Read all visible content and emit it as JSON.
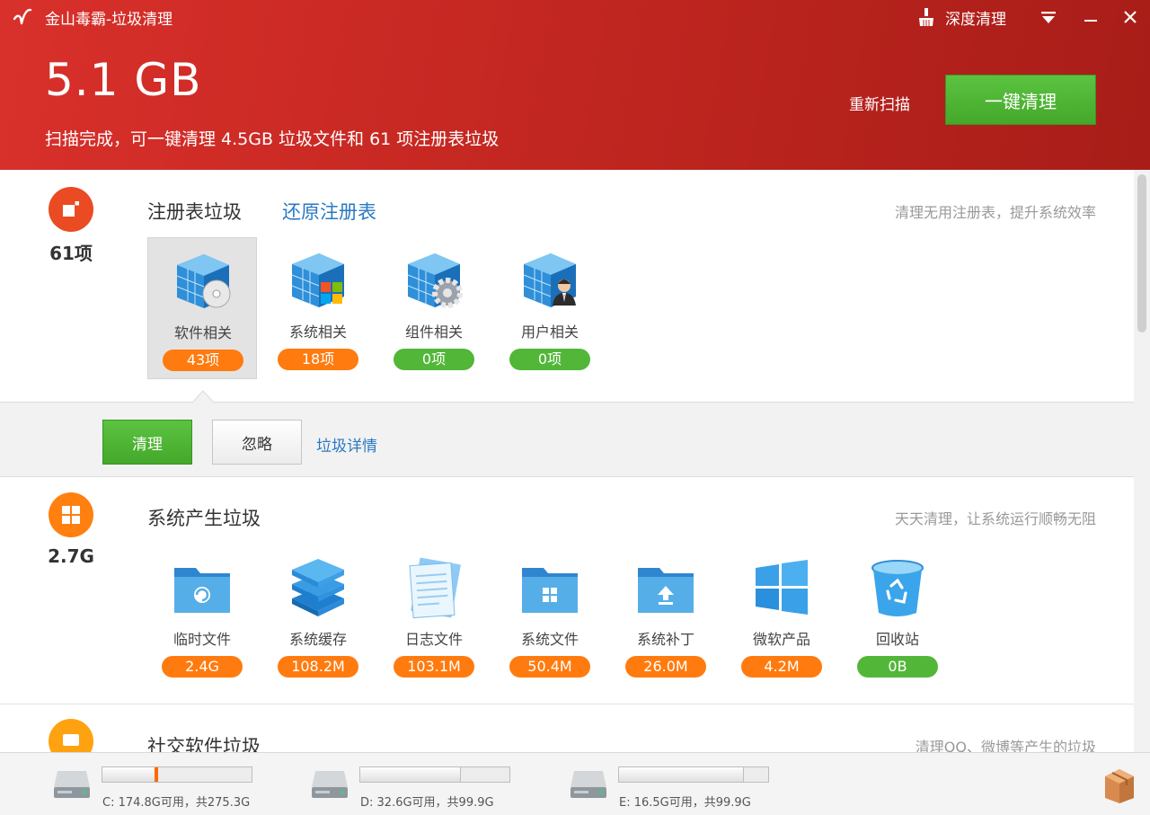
{
  "window": {
    "title": "金山毒霸-垃圾清理",
    "deep_clean_label": "深度清理"
  },
  "header": {
    "total_size": "5.1 GB",
    "summary": "扫描完成，可一键清理 4.5GB 垃圾文件和 61 项注册表垃圾",
    "rescan_label": "重新扫描",
    "one_click_label": "一键清理"
  },
  "registry": {
    "count": "61项",
    "title": "注册表垃圾",
    "restore_link": "还原注册表",
    "desc": "清理无用注册表，提升系统效率",
    "items": [
      {
        "label": "软件相关",
        "value": "43项",
        "status": "orange",
        "icon": "software-registry-icon"
      },
      {
        "label": "系统相关",
        "value": "18项",
        "status": "orange",
        "icon": "system-registry-icon"
      },
      {
        "label": "组件相关",
        "value": "0项",
        "status": "green",
        "icon": "component-registry-icon"
      },
      {
        "label": "用户相关",
        "value": "0项",
        "status": "green",
        "icon": "user-registry-icon"
      }
    ],
    "actions": {
      "clean": "清理",
      "ignore": "忽略",
      "detail": "垃圾详情"
    }
  },
  "system": {
    "count": "2.7G",
    "title": "系统产生垃圾",
    "desc": "天天清理，让系统运行顺畅无阻",
    "items": [
      {
        "label": "临时文件",
        "value": "2.4G",
        "status": "orange",
        "icon": "temp-folder-icon"
      },
      {
        "label": "系统缓存",
        "value": "108.2M",
        "status": "orange",
        "icon": "cache-stack-icon"
      },
      {
        "label": "日志文件",
        "value": "103.1M",
        "status": "orange",
        "icon": "log-file-icon"
      },
      {
        "label": "系统文件",
        "value": "50.4M",
        "status": "orange",
        "icon": "system-folder-icon"
      },
      {
        "label": "系统补丁",
        "value": "26.0M",
        "status": "orange",
        "icon": "patch-folder-icon"
      },
      {
        "label": "微软产品",
        "value": "4.2M",
        "status": "orange",
        "icon": "windows-logo-icon"
      },
      {
        "label": "回收站",
        "value": "0B",
        "status": "green",
        "icon": "recycle-bin-icon"
      }
    ]
  },
  "social": {
    "title": "社交软件垃圾",
    "desc": "清理QQ、微博等产生的垃圾"
  },
  "drives": [
    {
      "label": "C: 174.8G可用，共275.3G",
      "used_fraction": 0.365
    },
    {
      "label": "D: 32.6G可用，共99.9G",
      "used_fraction": 0.674
    },
    {
      "label": "E: 16.5G可用，共99.9G",
      "used_fraction": 0.835
    }
  ],
  "colors": {
    "header_red": "#c42721",
    "accent_green": "#52b738",
    "warn_orange": "#ff7b0f",
    "link_blue": "#2a79c2"
  }
}
